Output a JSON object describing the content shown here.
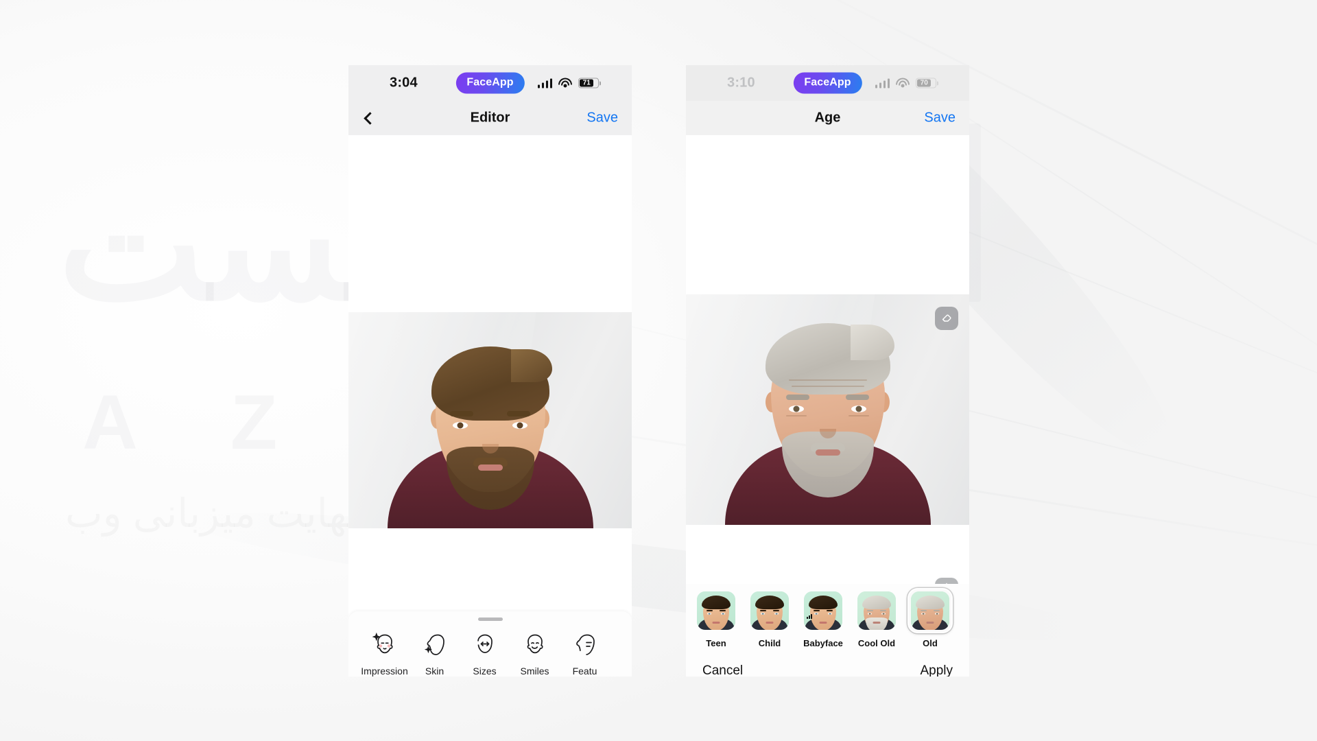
{
  "background": {
    "watermark_big": "ایست",
    "watermark_mid": "A Z",
    "watermark_sub": "سرعت بی نهایت میزبانی وب"
  },
  "phone_left": {
    "status_bar": {
      "time": "3:04",
      "app_badge": "FaceApp",
      "signal_icon": "cellular-signal-icon",
      "wifi_icon": "wifi-icon",
      "battery_level": "71"
    },
    "nav_bar": {
      "back_icon": "chevron-left-icon",
      "title": "Editor",
      "save_label": "Save"
    },
    "tools": [
      {
        "label": "Impression",
        "icon": "face-sparkle-icon"
      },
      {
        "label": "Skin",
        "icon": "face-skin-icon"
      },
      {
        "label": "Sizes",
        "icon": "face-arrows-icon"
      },
      {
        "label": "Smiles",
        "icon": "face-smile-icon"
      },
      {
        "label": "Featu",
        "icon": "face-features-icon"
      }
    ]
  },
  "phone_right": {
    "status_bar": {
      "time": "3:10",
      "app_badge": "FaceApp",
      "signal_icon": "cellular-signal-icon",
      "wifi_icon": "wifi-icon",
      "battery_level": "70"
    },
    "nav_bar": {
      "title": "Age",
      "save_label": "Save"
    },
    "floating_buttons": [
      {
        "name": "eraser-button",
        "icon": "eraser-icon"
      },
      {
        "name": "compare-button",
        "icon": "before-after-compare-icon"
      }
    ],
    "presets": [
      {
        "label": "Teen",
        "type": "young",
        "selected": false,
        "badge": false
      },
      {
        "label": "Child",
        "type": "young",
        "selected": false,
        "badge": false
      },
      {
        "label": "Babyface",
        "type": "young",
        "selected": false,
        "badge": true
      },
      {
        "label": "Cool Old",
        "type": "old",
        "selected": false,
        "badge": false
      },
      {
        "label": "Old",
        "type": "old",
        "selected": true,
        "badge": false
      }
    ],
    "actions": {
      "cancel_label": "Cancel",
      "apply_label": "Apply"
    }
  },
  "colors": {
    "accent_blue": "#1476f2",
    "badge_gradient_start": "#7c3df0",
    "badge_gradient_end": "#2a7ef0",
    "thumb_bg_green": "#c2e8d2",
    "shirt_maroon": "#5c242f"
  }
}
